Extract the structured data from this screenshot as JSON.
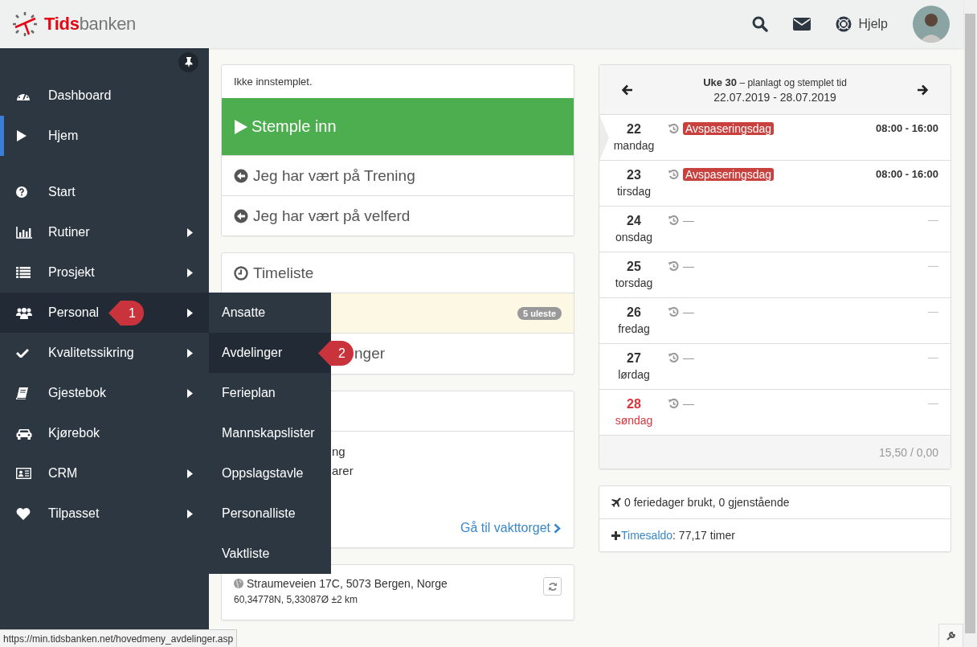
{
  "header": {
    "logo": {
      "accent": "Tids",
      "rest": "banken"
    },
    "help": "Hjelp"
  },
  "sidebar": {
    "pinned_items": [
      {
        "label": "Dashboard",
        "submenu": false,
        "selected": false,
        "open": false
      },
      {
        "label": "Hjem",
        "submenu": false,
        "selected": true,
        "open": false
      }
    ],
    "items": [
      {
        "label": "Start",
        "submenu": false,
        "selected": false,
        "open": false
      },
      {
        "label": "Rutiner",
        "submenu": true,
        "selected": false,
        "open": false
      },
      {
        "label": "Prosjekt",
        "submenu": true,
        "selected": false,
        "open": false
      },
      {
        "label": "Personal",
        "submenu": true,
        "selected": false,
        "open": true
      },
      {
        "label": "Kvalitetssikring",
        "submenu": true,
        "selected": false,
        "open": false
      },
      {
        "label": "Gjestebok",
        "submenu": true,
        "selected": false,
        "open": false
      },
      {
        "label": "Kjørebok",
        "submenu": false,
        "selected": false,
        "open": false
      },
      {
        "label": "CRM",
        "submenu": true,
        "selected": false,
        "open": false
      },
      {
        "label": "Tilpasset",
        "submenu": true,
        "selected": false,
        "open": false
      }
    ]
  },
  "submenu": {
    "items": [
      {
        "label": "Ansatte",
        "selected": false
      },
      {
        "label": "Avdelinger",
        "selected": true
      },
      {
        "label": "Ferieplan",
        "selected": false
      },
      {
        "label": "Mannskapslister",
        "selected": false
      },
      {
        "label": "Oppslagstavle",
        "selected": false
      },
      {
        "label": "Personalliste",
        "selected": false
      },
      {
        "label": "Vaktliste",
        "selected": false
      }
    ]
  },
  "callouts": [
    "1",
    "2"
  ],
  "clock_card": {
    "status": "Ikke innstemplet.",
    "primary": "Stemple inn",
    "actions": [
      "Jeg har vært på Trening",
      "Jeg har vært på velferd"
    ]
  },
  "timesheet_card": {
    "title": "Timeliste",
    "badge": "5 uleste",
    "row_fragment": "nger"
  },
  "shift_card": {
    "lines": [
      "ng",
      "arer"
    ],
    "link": "Gå til vakttorget"
  },
  "location_card": {
    "address": "Straumeveien 17C, 5073 Bergen, Norge",
    "coords": "60,34778N, 5,33087Ø ±2 km"
  },
  "week": {
    "title": "**Uke 30** – planlagt og stemplet tid",
    "range": "22.07.2019 - 28.07.2019",
    "days": [
      {
        "day": "22",
        "weekday": "mandag",
        "kind": "tag",
        "label": "Avspaseringsdag",
        "time": "08:00 - 16:00",
        "current": true,
        "holiday": false
      },
      {
        "day": "23",
        "weekday": "tirsdag",
        "kind": "tag",
        "label": "Avspaseringsdag",
        "time": "08:00 - 16:00",
        "current": false,
        "holiday": false
      },
      {
        "day": "24",
        "weekday": "onsdag",
        "kind": "plain",
        "label": "—",
        "time": "—",
        "current": false,
        "holiday": false
      },
      {
        "day": "25",
        "weekday": "torsdag",
        "kind": "plain",
        "label": "—",
        "time": "—",
        "current": false,
        "holiday": false
      },
      {
        "day": "26",
        "weekday": "fredag",
        "kind": "plain",
        "label": "—",
        "time": "—",
        "current": false,
        "holiday": false
      },
      {
        "day": "27",
        "weekday": "lørdag",
        "kind": "plain",
        "label": "—",
        "time": "—",
        "current": false,
        "holiday": false
      },
      {
        "day": "28",
        "weekday": "søndag",
        "kind": "plain",
        "label": "—",
        "time": "—",
        "current": false,
        "holiday": true
      }
    ],
    "total": "15,50 / 0,00"
  },
  "balance_card": {
    "vacation": "0 feriedager brukt, 0 gjenstående",
    "saldo_label": "Timesaldo",
    "saldo_value": ": 77,17 timer"
  },
  "status_bar": "https://min.tidsbanken.net/hovedmeny_avdelinger.asp"
}
